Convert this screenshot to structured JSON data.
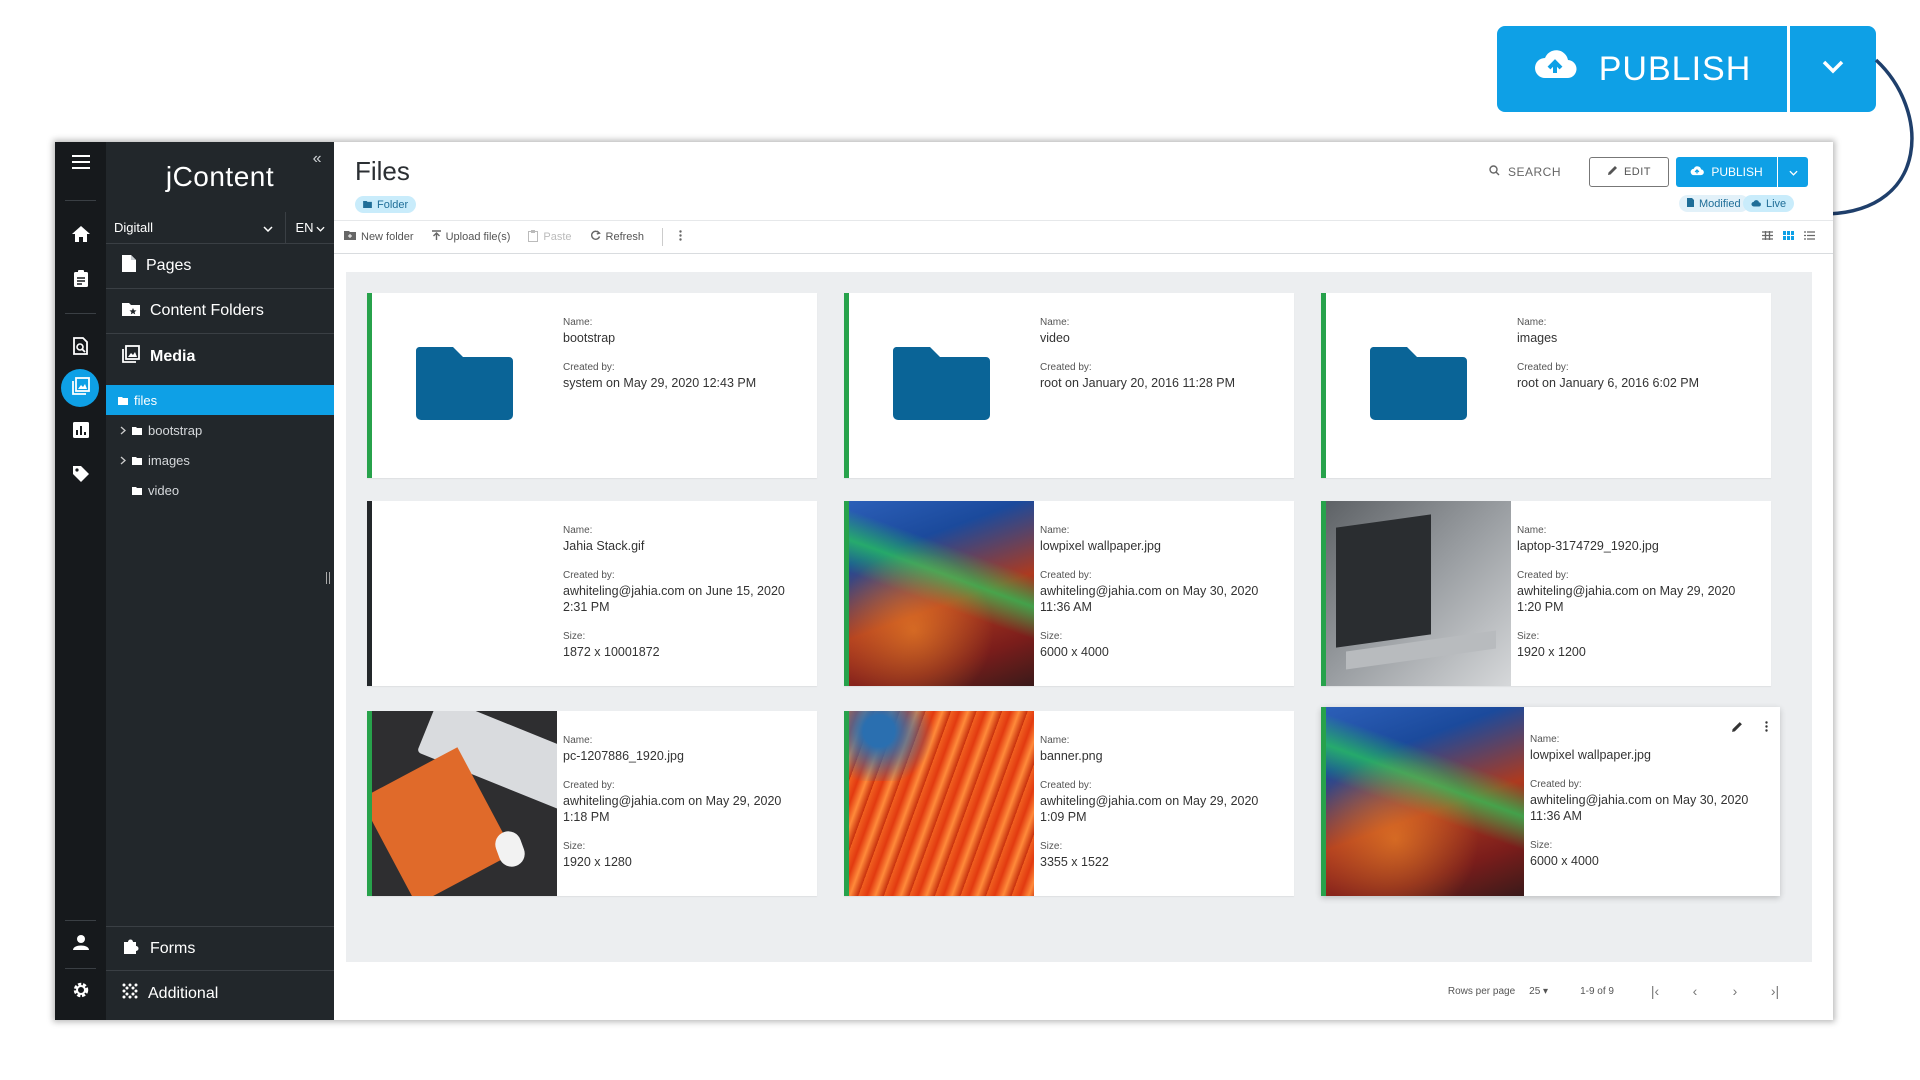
{
  "callout": {
    "publish_label": "PUBLISH"
  },
  "nav": {
    "brand": "jContent",
    "site": "Digitall",
    "lang": "EN",
    "items": [
      {
        "label": "Pages"
      },
      {
        "label": "Content Folders"
      },
      {
        "label": "Media"
      }
    ],
    "tree": [
      {
        "label": "files"
      },
      {
        "label": "bootstrap"
      },
      {
        "label": "images"
      },
      {
        "label": "video"
      }
    ],
    "bottom": [
      {
        "label": "Forms"
      },
      {
        "label": "Additional"
      }
    ]
  },
  "header": {
    "title": "Files",
    "type_chip": "Folder",
    "search_label": "SEARCH",
    "edit_label": "EDIT",
    "publish_label": "PUBLISH",
    "status_modified": "Modified",
    "status_live": "Live"
  },
  "toolbar": {
    "new_folder": "New folder",
    "upload": "Upload file(s)",
    "paste": "Paste",
    "refresh": "Refresh"
  },
  "labels": {
    "name": "Name:",
    "created_by": "Created by:",
    "size": "Size:"
  },
  "cards": [
    {
      "name": "bootstrap",
      "created": "system on May 29, 2020 12:43 PM"
    },
    {
      "name": "video",
      "created": "root on January 20, 2016 11:28 PM"
    },
    {
      "name": "images",
      "created": "root on January 6, 2016 6:02 PM"
    },
    {
      "name": "Jahia Stack.gif",
      "created": "awhiteling@jahia.com on June 15, 2020 2:31 PM",
      "size": "1872 x 10001872"
    },
    {
      "name": "lowpixel wallpaper.jpg",
      "created": "awhiteling@jahia.com on May 30, 2020 11:36 AM",
      "size": "6000 x 4000"
    },
    {
      "name": "laptop-3174729_1920.jpg",
      "created": "awhiteling@jahia.com on May 29, 2020 1:20 PM",
      "size": "1920 x 1200"
    },
    {
      "name": "pc-1207886_1920.jpg",
      "created": "awhiteling@jahia.com on May 29, 2020 1:18 PM",
      "size": "1920 x 1280"
    },
    {
      "name": "banner.png",
      "created": "awhiteling@jahia.com on May 29, 2020 1:09 PM",
      "size": "3355 x 1522"
    },
    {
      "name": "lowpixel wallpaper.jpg",
      "created": "awhiteling@jahia.com on May 30, 2020 11:36 AM",
      "size": "6000 x 4000"
    }
  ],
  "pager": {
    "rows_label": "Rows per page",
    "rows_value": "25",
    "range": "1-9 of 9"
  },
  "colors": {
    "accent": "#0ea0e6",
    "published": "#27a24b",
    "folder": "#0a6497",
    "rail": "#16191c",
    "nav": "#22272b"
  }
}
